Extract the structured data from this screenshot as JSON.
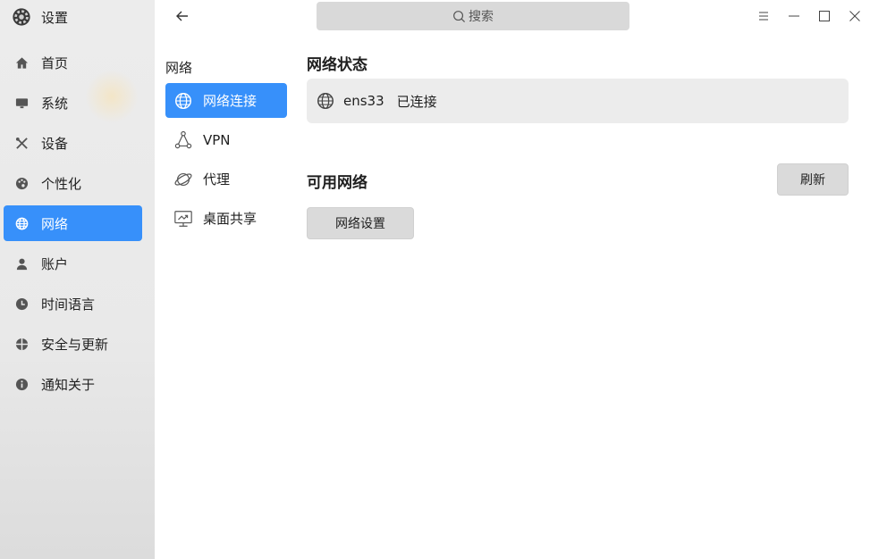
{
  "app": {
    "title": "设置",
    "icon": "gear-icon"
  },
  "sidebar": {
    "items": [
      {
        "label": "首页",
        "icon": "home-icon",
        "active": false
      },
      {
        "label": "系统",
        "icon": "monitor-icon",
        "active": false
      },
      {
        "label": "设备",
        "icon": "tools-icon",
        "active": false
      },
      {
        "label": "个性化",
        "icon": "palette-icon",
        "active": false
      },
      {
        "label": "网络",
        "icon": "globe-icon",
        "active": true
      },
      {
        "label": "账户",
        "icon": "user-icon",
        "active": false
      },
      {
        "label": "时间语言",
        "icon": "clock-icon",
        "active": false
      },
      {
        "label": "安全与更新",
        "icon": "shield-icon",
        "active": false
      },
      {
        "label": "通知关于",
        "icon": "info-icon",
        "active": false
      }
    ]
  },
  "topbar": {
    "search_placeholder": "搜索",
    "controls": [
      "menu-icon",
      "minimize-icon",
      "maximize-icon",
      "close-icon"
    ]
  },
  "subnav": {
    "title": "网络",
    "items": [
      {
        "label": "网络连接",
        "icon": "network-globe-icon",
        "active": true
      },
      {
        "label": "VPN",
        "icon": "vpn-icon",
        "active": false
      },
      {
        "label": "代理",
        "icon": "proxy-icon",
        "active": false
      },
      {
        "label": "桌面共享",
        "icon": "screen-share-icon",
        "active": false
      }
    ]
  },
  "main": {
    "status_heading": "网络状态",
    "status": {
      "interface": "ens33",
      "state": "已连接"
    },
    "available_heading": "可用网络",
    "refresh_label": "刷新",
    "network_settings_label": "网络设置"
  },
  "colors": {
    "accent": "#3790fa",
    "sidebar_bg": "#ececec",
    "card_bg": "#ececec",
    "button_bg": "#dadada"
  }
}
